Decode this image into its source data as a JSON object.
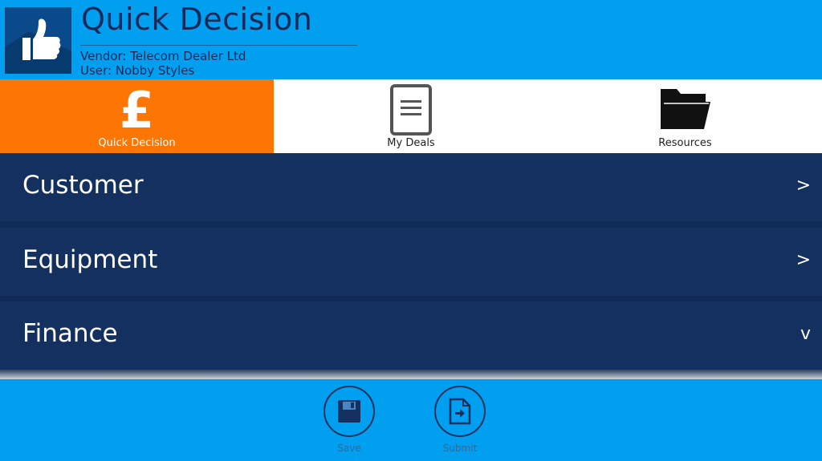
{
  "header": {
    "title": "Quick Decision",
    "vendor": "Vendor: Telecom Dealer Ltd",
    "user": "User: Nobby Styles",
    "logo_icon": "thumbs-up-icon"
  },
  "tabs": [
    {
      "label": "Quick Decision",
      "icon": "pound-icon",
      "active": true
    },
    {
      "label": "My Deals",
      "icon": "document-icon",
      "active": false
    },
    {
      "label": "Resources",
      "icon": "folder-icon",
      "active": false
    }
  ],
  "tab_pound_glyph": "£",
  "sections": [
    {
      "label": "Customer",
      "indicator": ">"
    },
    {
      "label": "Equipment",
      "indicator": ">"
    },
    {
      "label": "Finance",
      "indicator": "v"
    }
  ],
  "footer": {
    "save_label": "Save",
    "submit_label": "Submit"
  },
  "colors": {
    "background": "#019ff0",
    "active_tab": "#fd7503",
    "section_bg": "#13305e",
    "title_text": "#15295a"
  }
}
